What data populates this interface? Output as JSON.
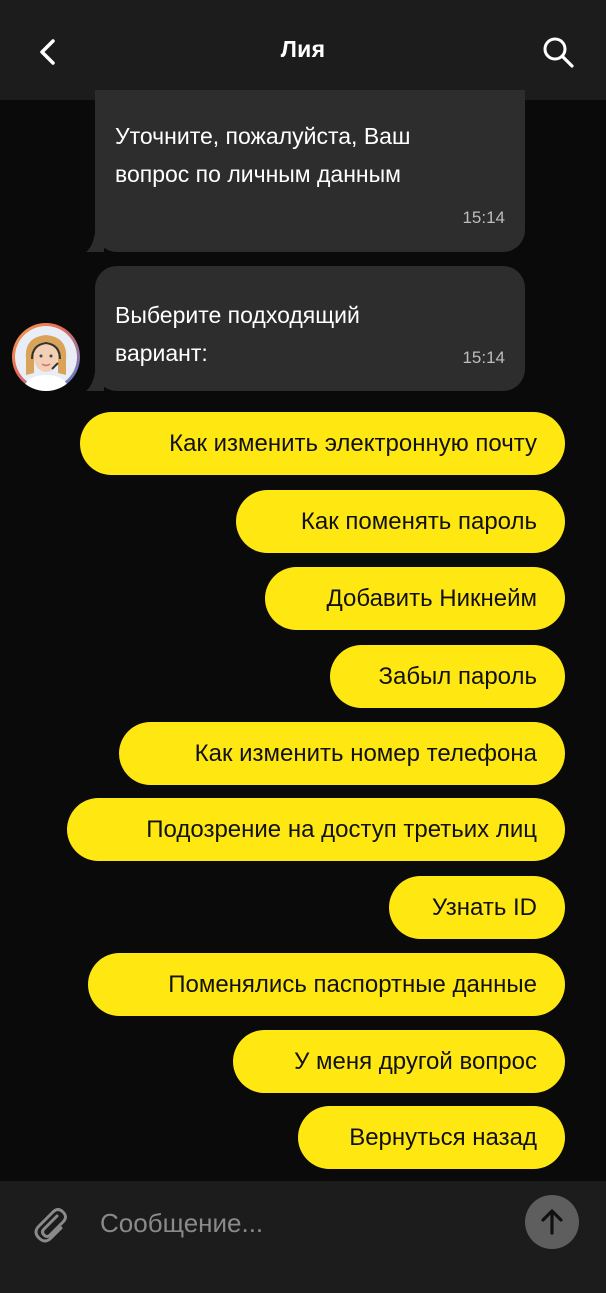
{
  "header": {
    "title": "Лия",
    "back_icon": "chevron-left-icon",
    "search_icon": "search-icon"
  },
  "messages": [
    {
      "text_line1": "Уточните, пожалуйста, Ваш",
      "text_line2": "вопрос по личным данным",
      "time": "15:14"
    },
    {
      "text_line1": "Выберите подходящий",
      "text_line2": "вариант:",
      "time": "15:14"
    }
  ],
  "options": [
    "Как изменить электронную почту",
    "Как поменять пароль",
    "Добавить Никнейм",
    "Забыл пароль",
    "Как изменить номер телефона",
    "Подозрение на доступ третьих лиц",
    "Узнать ID",
    "Поменялись паспортные данные",
    "У меня другой вопрос",
    "Вернуться назад"
  ],
  "composer": {
    "placeholder": "Сообщение...",
    "attach_icon": "paperclip-icon",
    "send_icon": "arrow-up-icon"
  },
  "colors": {
    "background": "#0a0a0a",
    "header": "#1c1c1c",
    "bubble": "#2d2d2d",
    "option": "#ffe812",
    "send_button": "#5e5e5e"
  }
}
